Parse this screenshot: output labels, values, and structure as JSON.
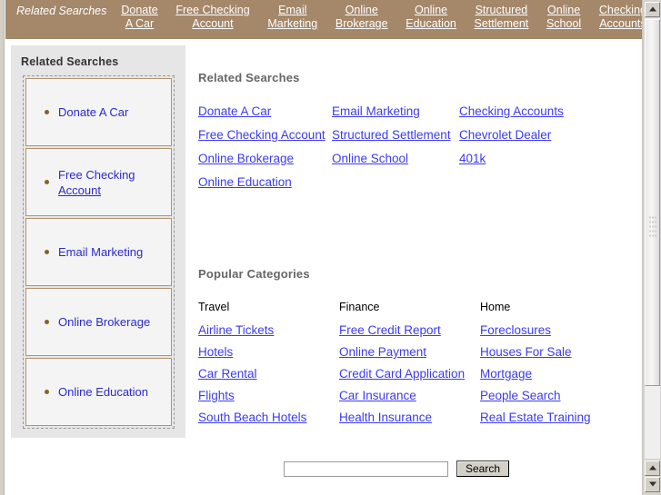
{
  "topbar": {
    "title": "Related Searches",
    "background_color": "#a5876a",
    "text_color": "#ffffff",
    "links": [
      {
        "line1": "Donate",
        "line2": "A Car"
      },
      {
        "line1": "Free Checking",
        "line2": "Account"
      },
      {
        "line1": "Email",
        "line2": "Marketing"
      },
      {
        "line1": "Online",
        "line2": "Brokerage"
      },
      {
        "line1": "Online",
        "line2": "Education"
      },
      {
        "line1": "Structured",
        "line2": "Settlement"
      },
      {
        "line1": "Online",
        "line2": "School"
      },
      {
        "line1": "Checking",
        "line2": "Accounts"
      }
    ]
  },
  "sidebar": {
    "heading": "Related Searches",
    "background_color": "#e6e6e6",
    "item_border_color": "#b39370",
    "bullet_color": "#8a5f2b",
    "link_color": "#2a2ad0",
    "items": [
      {
        "label": "Donate A Car",
        "wrapped": false
      },
      {
        "label": "Free Checking",
        "label2": "Account",
        "wrapped": true
      },
      {
        "label": "Email Marketing",
        "wrapped": false
      },
      {
        "label": "Online Brokerage",
        "wrapped": false
      },
      {
        "label": "Online Education",
        "wrapped": false
      }
    ]
  },
  "related_searches": {
    "heading": "Related Searches",
    "link_color": "#3b3bf0",
    "links": [
      "Donate A Car",
      "Email Marketing",
      "Checking Accounts",
      "Free Checking Account",
      "Structured Settlement",
      "Chevrolet Dealer",
      "Online Brokerage",
      "Online School",
      "401k",
      "Online Education"
    ]
  },
  "popular_categories": {
    "heading": "Popular Categories",
    "columns": [
      {
        "title": "Travel",
        "links": [
          "Airline Tickets",
          "Hotels",
          "Car Rental",
          "Flights",
          "South Beach Hotels"
        ]
      },
      {
        "title": "Finance",
        "links": [
          "Free Credit Report",
          "Online Payment",
          "Credit Card Application",
          "Car Insurance",
          "Health Insurance"
        ]
      },
      {
        "title": "Home",
        "links": [
          "Foreclosures",
          "Houses For Sale",
          "Mortgage",
          "People Search",
          "Real Estate Training"
        ]
      }
    ]
  },
  "search": {
    "value": "",
    "placeholder": "",
    "button_label": "Search"
  },
  "scrollbar": {
    "up_arrow": "▲",
    "down_arrow": "▼"
  }
}
